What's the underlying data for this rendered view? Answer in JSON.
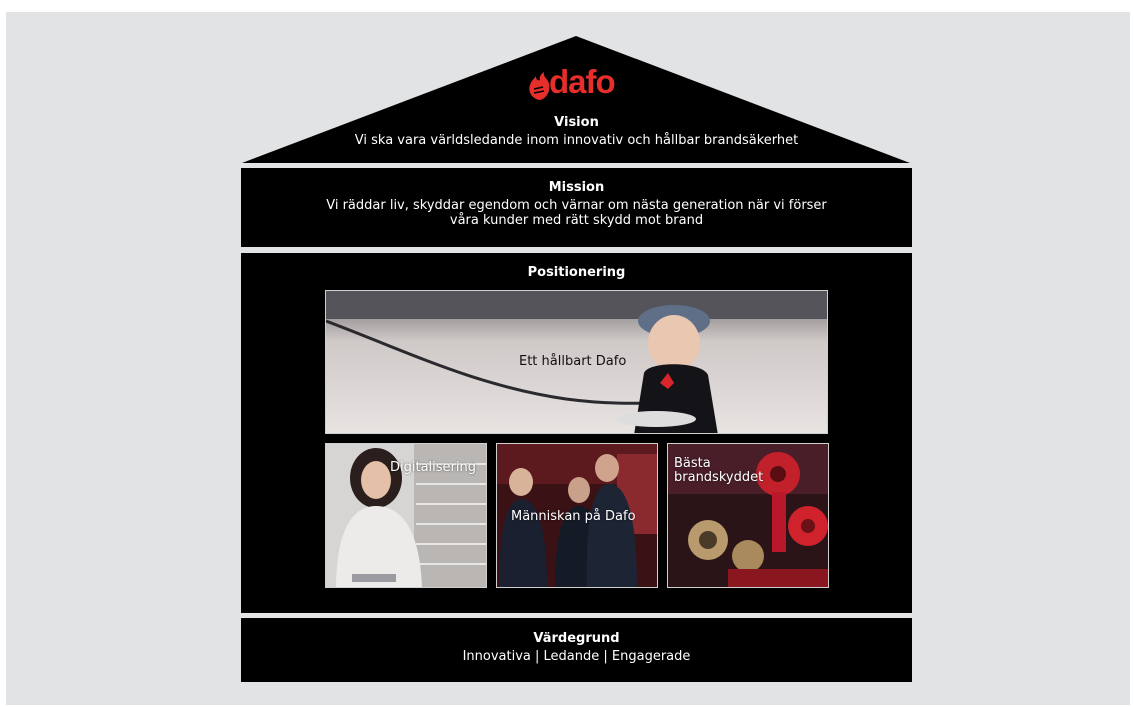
{
  "brand": {
    "logo_text": "dafo",
    "color": "#e62e2b"
  },
  "vision": {
    "title": "Vision",
    "text": "Vi ska vara världsledande inom innovativ och hållbar brandsäkerhet"
  },
  "mission": {
    "title": "Mission",
    "line1": "Vi räddar liv, skyddar egendom och värnar om nästa generation när vi förser",
    "line2": "våra kunder med rätt skydd mot brand"
  },
  "positioning": {
    "title": "Positionering",
    "main_caption": "Ett hållbart Dafo",
    "tiles": [
      {
        "caption": "Digitalisering"
      },
      {
        "caption": "Människan på Dafo"
      },
      {
        "caption_line1": "Bästa",
        "caption_line2": "brandskyddet"
      }
    ]
  },
  "values": {
    "title": "Värdegrund",
    "text": "Innovativa | Ledande | Engagerade"
  }
}
